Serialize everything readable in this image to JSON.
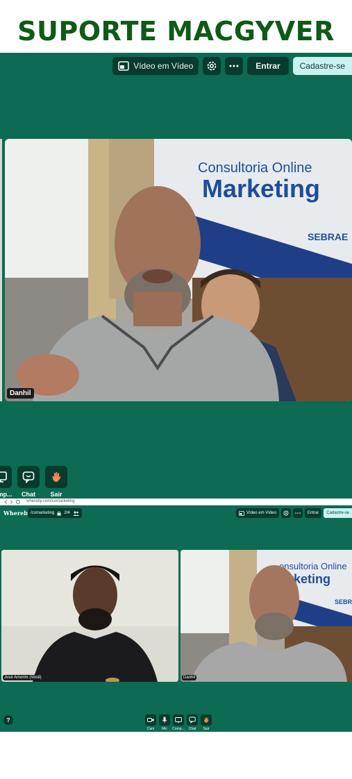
{
  "header": {
    "title": "SUPORTE MACGYVER"
  },
  "meeting_top": {
    "toolbar": {
      "pip_label": "Vídeo em Vídeo",
      "enter_label": "Entrar",
      "signup_label": "Cadastre-se"
    },
    "participant_name": "Danhil",
    "banner": {
      "line1": "Consultoria Online",
      "line2": "Marketing",
      "brand": "SEBRAE"
    },
    "controls": [
      {
        "label": "Comp...",
        "icon": "screen-share-icon"
      },
      {
        "label": "Chat",
        "icon": "chat-icon"
      },
      {
        "label": "Sair",
        "icon": "wave-hand-icon"
      }
    ]
  },
  "browser": {
    "url": "whereby.com/comarketing"
  },
  "meeting_bottom": {
    "brand": "Whereby",
    "room_name": "/comarketing",
    "participant_count": "2/4",
    "toolbar": {
      "pip_label": "Vídeo em Vídeo",
      "enter_label": "Entrar",
      "signup_label": "Cadastre-se"
    },
    "participants": [
      {
        "name": "José Amorim (Você)"
      },
      {
        "name": "Danhil"
      }
    ],
    "banner": {
      "line1": "onsultoria Online",
      "line2": "arketing",
      "brand": "SEBR"
    },
    "help_label": "?",
    "controls": [
      {
        "label": "Cam",
        "icon": "camera-icon"
      },
      {
        "label": "Mic",
        "icon": "microphone-icon"
      },
      {
        "label": "Comp...",
        "icon": "screen-share-icon"
      },
      {
        "label": "Chat",
        "icon": "chat-icon"
      },
      {
        "label": "Sair",
        "icon": "wave-hand-icon"
      }
    ]
  },
  "colors": {
    "panel_bg": "#0c6b52",
    "button_bg": "#063b2e",
    "title": "#0f5a17",
    "signup_bg": "#c9f2f0"
  }
}
